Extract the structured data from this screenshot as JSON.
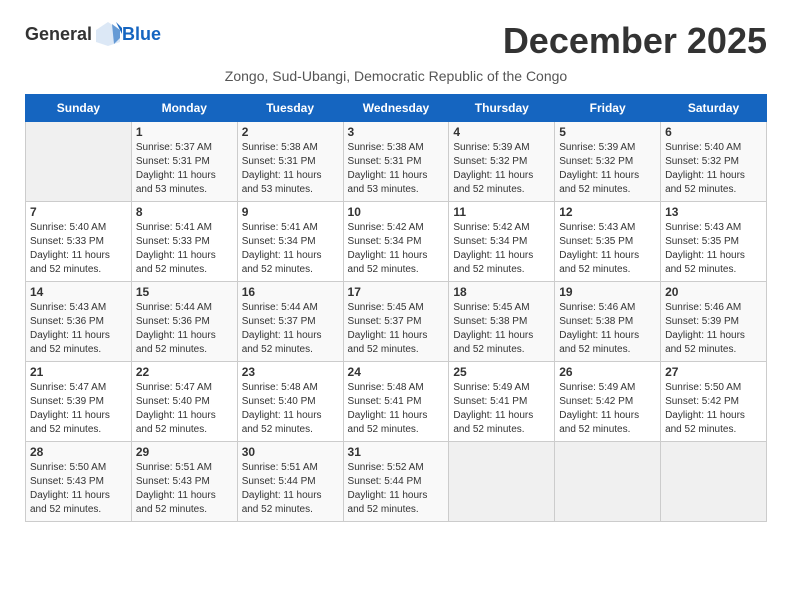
{
  "header": {
    "logo_general": "General",
    "logo_blue": "Blue",
    "title": "December 2025",
    "subtitle": "Zongo, Sud-Ubangi, Democratic Republic of the Congo"
  },
  "weekdays": [
    "Sunday",
    "Monday",
    "Tuesday",
    "Wednesday",
    "Thursday",
    "Friday",
    "Saturday"
  ],
  "weeks": [
    [
      {
        "day": "",
        "info": ""
      },
      {
        "day": "1",
        "info": "Sunrise: 5:37 AM\nSunset: 5:31 PM\nDaylight: 11 hours\nand 53 minutes."
      },
      {
        "day": "2",
        "info": "Sunrise: 5:38 AM\nSunset: 5:31 PM\nDaylight: 11 hours\nand 53 minutes."
      },
      {
        "day": "3",
        "info": "Sunrise: 5:38 AM\nSunset: 5:31 PM\nDaylight: 11 hours\nand 53 minutes."
      },
      {
        "day": "4",
        "info": "Sunrise: 5:39 AM\nSunset: 5:32 PM\nDaylight: 11 hours\nand 52 minutes."
      },
      {
        "day": "5",
        "info": "Sunrise: 5:39 AM\nSunset: 5:32 PM\nDaylight: 11 hours\nand 52 minutes."
      },
      {
        "day": "6",
        "info": "Sunrise: 5:40 AM\nSunset: 5:32 PM\nDaylight: 11 hours\nand 52 minutes."
      }
    ],
    [
      {
        "day": "7",
        "info": "Sunrise: 5:40 AM\nSunset: 5:33 PM\nDaylight: 11 hours\nand 52 minutes."
      },
      {
        "day": "8",
        "info": "Sunrise: 5:41 AM\nSunset: 5:33 PM\nDaylight: 11 hours\nand 52 minutes."
      },
      {
        "day": "9",
        "info": "Sunrise: 5:41 AM\nSunset: 5:34 PM\nDaylight: 11 hours\nand 52 minutes."
      },
      {
        "day": "10",
        "info": "Sunrise: 5:42 AM\nSunset: 5:34 PM\nDaylight: 11 hours\nand 52 minutes."
      },
      {
        "day": "11",
        "info": "Sunrise: 5:42 AM\nSunset: 5:34 PM\nDaylight: 11 hours\nand 52 minutes."
      },
      {
        "day": "12",
        "info": "Sunrise: 5:43 AM\nSunset: 5:35 PM\nDaylight: 11 hours\nand 52 minutes."
      },
      {
        "day": "13",
        "info": "Sunrise: 5:43 AM\nSunset: 5:35 PM\nDaylight: 11 hours\nand 52 minutes."
      }
    ],
    [
      {
        "day": "14",
        "info": "Sunrise: 5:43 AM\nSunset: 5:36 PM\nDaylight: 11 hours\nand 52 minutes."
      },
      {
        "day": "15",
        "info": "Sunrise: 5:44 AM\nSunset: 5:36 PM\nDaylight: 11 hours\nand 52 minutes."
      },
      {
        "day": "16",
        "info": "Sunrise: 5:44 AM\nSunset: 5:37 PM\nDaylight: 11 hours\nand 52 minutes."
      },
      {
        "day": "17",
        "info": "Sunrise: 5:45 AM\nSunset: 5:37 PM\nDaylight: 11 hours\nand 52 minutes."
      },
      {
        "day": "18",
        "info": "Sunrise: 5:45 AM\nSunset: 5:38 PM\nDaylight: 11 hours\nand 52 minutes."
      },
      {
        "day": "19",
        "info": "Sunrise: 5:46 AM\nSunset: 5:38 PM\nDaylight: 11 hours\nand 52 minutes."
      },
      {
        "day": "20",
        "info": "Sunrise: 5:46 AM\nSunset: 5:39 PM\nDaylight: 11 hours\nand 52 minutes."
      }
    ],
    [
      {
        "day": "21",
        "info": "Sunrise: 5:47 AM\nSunset: 5:39 PM\nDaylight: 11 hours\nand 52 minutes."
      },
      {
        "day": "22",
        "info": "Sunrise: 5:47 AM\nSunset: 5:40 PM\nDaylight: 11 hours\nand 52 minutes."
      },
      {
        "day": "23",
        "info": "Sunrise: 5:48 AM\nSunset: 5:40 PM\nDaylight: 11 hours\nand 52 minutes."
      },
      {
        "day": "24",
        "info": "Sunrise: 5:48 AM\nSunset: 5:41 PM\nDaylight: 11 hours\nand 52 minutes."
      },
      {
        "day": "25",
        "info": "Sunrise: 5:49 AM\nSunset: 5:41 PM\nDaylight: 11 hours\nand 52 minutes."
      },
      {
        "day": "26",
        "info": "Sunrise: 5:49 AM\nSunset: 5:42 PM\nDaylight: 11 hours\nand 52 minutes."
      },
      {
        "day": "27",
        "info": "Sunrise: 5:50 AM\nSunset: 5:42 PM\nDaylight: 11 hours\nand 52 minutes."
      }
    ],
    [
      {
        "day": "28",
        "info": "Sunrise: 5:50 AM\nSunset: 5:43 PM\nDaylight: 11 hours\nand 52 minutes."
      },
      {
        "day": "29",
        "info": "Sunrise: 5:51 AM\nSunset: 5:43 PM\nDaylight: 11 hours\nand 52 minutes."
      },
      {
        "day": "30",
        "info": "Sunrise: 5:51 AM\nSunset: 5:44 PM\nDaylight: 11 hours\nand 52 minutes."
      },
      {
        "day": "31",
        "info": "Sunrise: 5:52 AM\nSunset: 5:44 PM\nDaylight: 11 hours\nand 52 minutes."
      },
      {
        "day": "",
        "info": ""
      },
      {
        "day": "",
        "info": ""
      },
      {
        "day": "",
        "info": ""
      }
    ]
  ]
}
